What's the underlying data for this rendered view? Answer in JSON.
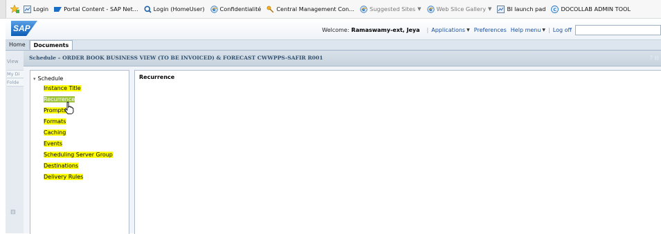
{
  "favorites": [
    {
      "label": "Login",
      "icon": "image-icon",
      "caret": false,
      "grey": false
    },
    {
      "label": "Portal Content - SAP Net...",
      "icon": "sap-portal-icon",
      "caret": false,
      "grey": false
    },
    {
      "label": "Login (HomeUser)",
      "icon": "search-q-icon",
      "caret": false,
      "grey": false
    },
    {
      "label": "Confidentialité",
      "icon": "ie-page-icon",
      "caret": false,
      "grey": false
    },
    {
      "label": "Central Management Con...",
      "icon": "cms-key-icon",
      "caret": false,
      "grey": false
    },
    {
      "label": "Suggested Sites",
      "icon": "ie-page-icon",
      "caret": true,
      "grey": true
    },
    {
      "label": "Web Slice Gallery",
      "icon": "ie-page-icon",
      "caret": true,
      "grey": true
    },
    {
      "label": "BI launch pad",
      "icon": "image-icon",
      "caret": false,
      "grey": false
    },
    {
      "label": "DOCOLLAB ADMIN TOOL",
      "icon": "docollab-icon",
      "caret": false,
      "grey": false
    }
  ],
  "header": {
    "logo_text": "SAP",
    "welcome_label": "Welcome:",
    "user_name": "Ramaswamy-ext, Jeya",
    "applications": "Applications",
    "preferences": "Preferences",
    "help_menu": "Help menu",
    "log_off": "Log off",
    "search_value": ""
  },
  "tabs": [
    {
      "label": "Home",
      "active": false
    },
    {
      "label": "Documents",
      "active": true
    }
  ],
  "rail": {
    "view": "View",
    "my_documents": "My Di",
    "folders": "Folde",
    "collapse": "⊟"
  },
  "dialog": {
    "title": "Schedule – ORDER BOOK BUSINESS VIEW (TO BE INVOICED) & FORECAST CWWPPS-SAFIR R001",
    "help": "?",
    "minimize": "⊟",
    "tree_root": "Schedule",
    "nav": [
      {
        "label": "Instance Title",
        "selected": false
      },
      {
        "label": "Recurrence",
        "selected": true
      },
      {
        "label": "Prompts",
        "selected": false
      },
      {
        "label": "Formats",
        "selected": false
      },
      {
        "label": "Caching",
        "selected": false
      },
      {
        "label": "Events",
        "selected": false
      },
      {
        "label": "Scheduling Server Group",
        "selected": false
      },
      {
        "label": "Destinations",
        "selected": false
      },
      {
        "label": "Delivery Rules",
        "selected": false
      }
    ],
    "content_heading": "Recurrence"
  },
  "colors": {
    "highlight": "#ffff00",
    "selected_highlight": "#9fc23b",
    "title_text": "#33516f",
    "link": "#1b4f9c",
    "sap_blue": "#1a6fc4"
  }
}
